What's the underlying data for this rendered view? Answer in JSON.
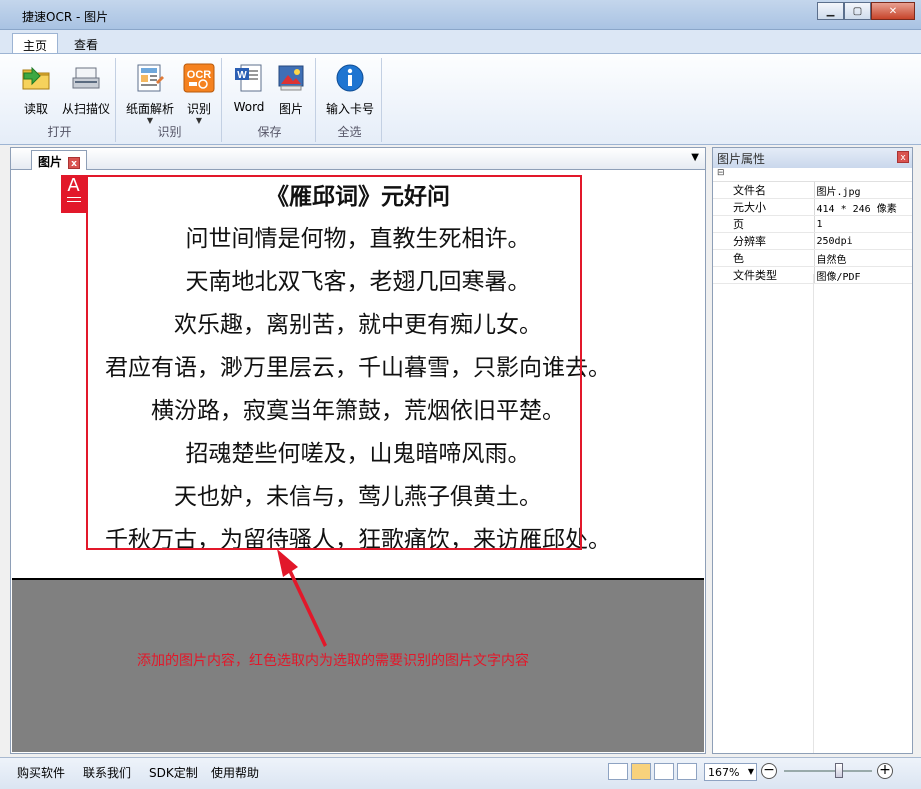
{
  "window": {
    "title": "捷速OCR - 图片",
    "minimize": "▁",
    "maximize": "▢",
    "close": "✕"
  },
  "ribbon": {
    "tabs": [
      {
        "label": "主页",
        "active": true
      },
      {
        "label": "查看",
        "active": false
      }
    ],
    "groups": [
      {
        "label": "打开",
        "buttons": [
          {
            "label": "读取",
            "icon": "folder-icon"
          },
          {
            "label": "从扫描仪",
            "icon": "scanner-icon"
          }
        ]
      },
      {
        "label": "识别",
        "buttons": [
          {
            "label": "纸面解析",
            "icon": "layout-analysis-icon"
          },
          {
            "label": "识别",
            "icon": "ocr-icon"
          }
        ]
      },
      {
        "label": "保存",
        "buttons": [
          {
            "label": "Word",
            "icon": "word-icon"
          },
          {
            "label": "图片",
            "icon": "picture-icon"
          }
        ]
      },
      {
        "label": "全选",
        "buttons": [
          {
            "label": "输入卡号",
            "icon": "info-icon"
          }
        ]
      }
    ],
    "ocr_icon_text": "OCR"
  },
  "document": {
    "tab_label": "图片",
    "tab_close": "x",
    "selection_badge": "A",
    "poem": [
      "《雁邱词》元好问",
      "问世间情是何物，直教生死相许。",
      "天南地北双飞客，老翅几回寒暑。",
      "欢乐趣，离别苦，就中更有痴儿女。",
      "君应有语，渺万里层云，千山暮雪，只影向谁去。",
      "横汾路，寂寞当年箫鼓，荒烟依旧平楚。",
      "招魂楚些何嗟及，山鬼暗啼风雨。",
      "天也妒，未信与，莺儿燕子俱黄土。",
      "千秋万古，为留待骚人，狂歌痛饮，来访雁邱处。"
    ],
    "annotation": "添加的图片内容，红色选取内为选取的需要识别的图片文字内容",
    "colors": {
      "selection": "#e2182a",
      "gray": "#808080"
    }
  },
  "properties": {
    "title": "图片属性",
    "collapse": "⊟",
    "rows": [
      {
        "key": "文件名",
        "value": "图片.jpg"
      },
      {
        "key": "元大小",
        "value": "414 * 246 像素"
      },
      {
        "key": "页",
        "value": "1"
      },
      {
        "key": "分辨率",
        "value": "250dpi"
      },
      {
        "key": "色",
        "value": "自然色"
      },
      {
        "key": "文件类型",
        "value": "图像/PDF"
      }
    ]
  },
  "statusbar": {
    "links": [
      "购买软件",
      "联系我们",
      "SDK定制",
      "使用帮助"
    ],
    "zoom": "167%",
    "zoom_minus": "−",
    "zoom_plus": "+"
  }
}
